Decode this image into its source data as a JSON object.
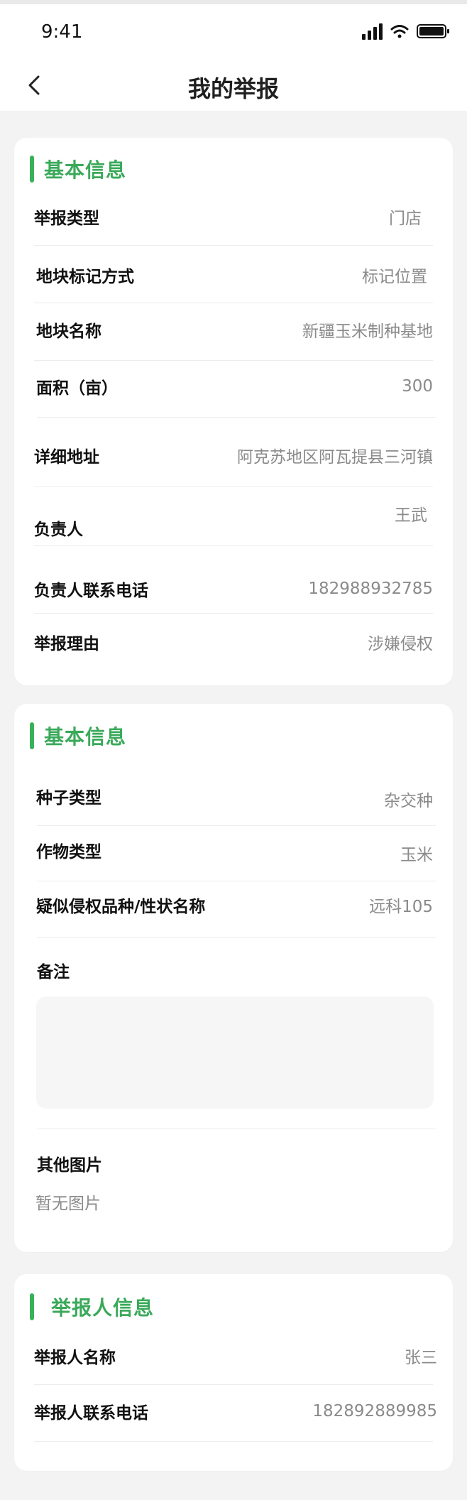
{
  "status_bar": {
    "time": "9:41",
    "icons": [
      "signal-icon",
      "wifi-icon",
      "battery-icon"
    ]
  },
  "nav": {
    "title": "我的举报",
    "back_icon": "chevron-left-icon"
  },
  "colors": {
    "accent": "#39b15a",
    "section_title": "#3aa95a",
    "background": "#f3f3f3",
    "muted_text": "#8a8a8a"
  },
  "cards": [
    {
      "title": "基本信息",
      "rows": [
        {
          "label": "举报类型",
          "value": "门店"
        },
        {
          "label": "地块标记方式",
          "value": "标记位置"
        },
        {
          "label": "地块名称",
          "value": "新疆玉米制种基地"
        },
        {
          "label": "面积（亩）",
          "value": "300"
        },
        {
          "label": "详细地址",
          "value": "阿克苏地区阿瓦提县三河镇"
        },
        {
          "label": "负责人",
          "value": "王武"
        },
        {
          "label": "负责人联系电话",
          "value": "182988932785"
        },
        {
          "label": "举报理由",
          "value": "涉嫌侵权"
        }
      ]
    },
    {
      "title": "基本信息",
      "rows": [
        {
          "label": "种子类型",
          "value": "杂交种"
        },
        {
          "label": "作物类型",
          "value": "玉米"
        },
        {
          "label": "疑似侵权品种/性状名称",
          "value": "远科105"
        }
      ],
      "remark_label": "备注",
      "remark_value": "",
      "images_label": "其他图片",
      "images_empty_text": "暂无图片"
    },
    {
      "title": "举报人信息",
      "rows": [
        {
          "label": "举报人名称",
          "value": "张三"
        },
        {
          "label": "举报人联系电话",
          "value": "182892889985"
        }
      ]
    }
  ]
}
